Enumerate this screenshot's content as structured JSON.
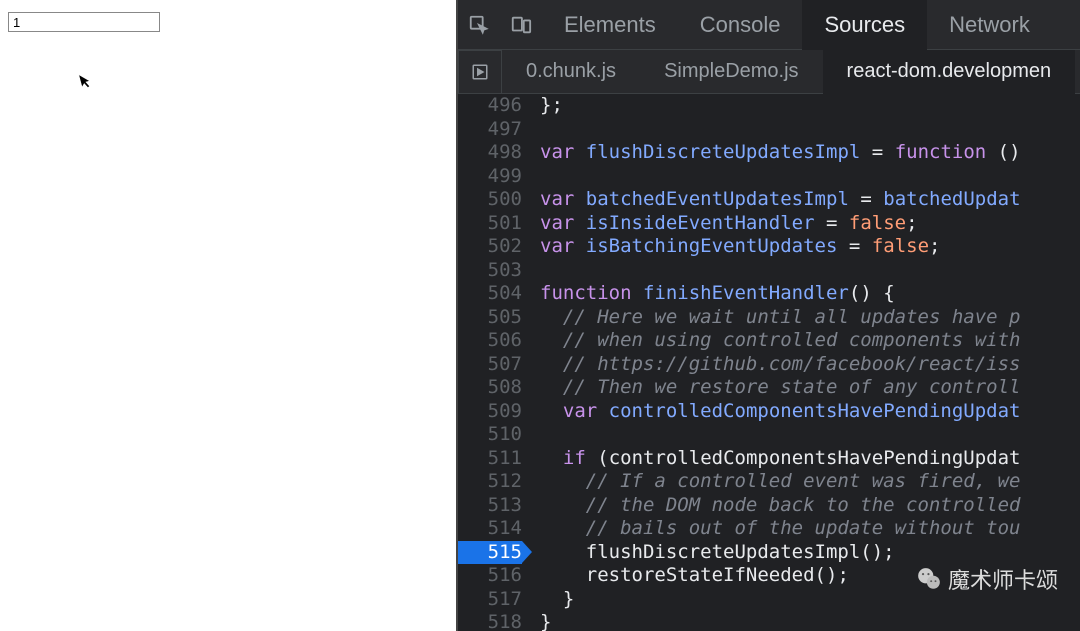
{
  "leftPane": {
    "inputValue": "1"
  },
  "devtools": {
    "mainTabs": [
      "Elements",
      "Console",
      "Sources",
      "Network"
    ],
    "activeMainTab": "Sources",
    "fileTabs": [
      "0.chunk.js",
      "SimpleDemo.js",
      "react-dom.developmen"
    ],
    "activeFileTab": "react-dom.developmen"
  },
  "code": {
    "startLine": 496,
    "highlightedLine": 515,
    "lines": [
      {
        "n": 496,
        "t": [
          {
            "c": "punct",
            "v": "};"
          }
        ]
      },
      {
        "n": 497,
        "t": []
      },
      {
        "n": 498,
        "t": [
          {
            "c": "kw",
            "v": "var"
          },
          {
            "c": "id",
            "v": " "
          },
          {
            "c": "fname",
            "v": "flushDiscreteUpdatesImpl"
          },
          {
            "c": "id",
            "v": " "
          },
          {
            "c": "punct",
            "v": "="
          },
          {
            "c": "id",
            "v": " "
          },
          {
            "c": "kw",
            "v": "function"
          },
          {
            "c": "id",
            "v": " "
          },
          {
            "c": "punct",
            "v": "()"
          }
        ]
      },
      {
        "n": 499,
        "t": []
      },
      {
        "n": 500,
        "t": [
          {
            "c": "kw",
            "v": "var"
          },
          {
            "c": "id",
            "v": " "
          },
          {
            "c": "fname",
            "v": "batchedEventUpdatesImpl"
          },
          {
            "c": "id",
            "v": " "
          },
          {
            "c": "punct",
            "v": "="
          },
          {
            "c": "id",
            "v": " "
          },
          {
            "c": "fname",
            "v": "batchedUpdat"
          }
        ]
      },
      {
        "n": 501,
        "t": [
          {
            "c": "kw",
            "v": "var"
          },
          {
            "c": "id",
            "v": " "
          },
          {
            "c": "fname",
            "v": "isInsideEventHandler"
          },
          {
            "c": "id",
            "v": " "
          },
          {
            "c": "punct",
            "v": "="
          },
          {
            "c": "id",
            "v": " "
          },
          {
            "c": "bool",
            "v": "false"
          },
          {
            "c": "punct",
            "v": ";"
          }
        ]
      },
      {
        "n": 502,
        "t": [
          {
            "c": "kw",
            "v": "var"
          },
          {
            "c": "id",
            "v": " "
          },
          {
            "c": "fname",
            "v": "isBatchingEventUpdates"
          },
          {
            "c": "id",
            "v": " "
          },
          {
            "c": "punct",
            "v": "="
          },
          {
            "c": "id",
            "v": " "
          },
          {
            "c": "bool",
            "v": "false"
          },
          {
            "c": "punct",
            "v": ";"
          }
        ]
      },
      {
        "n": 503,
        "t": []
      },
      {
        "n": 504,
        "t": [
          {
            "c": "kw",
            "v": "function"
          },
          {
            "c": "id",
            "v": " "
          },
          {
            "c": "fdec",
            "v": "finishEventHandler"
          },
          {
            "c": "punct",
            "v": "() {"
          }
        ]
      },
      {
        "n": 505,
        "t": [
          {
            "c": "id",
            "v": "  "
          },
          {
            "c": "comment",
            "v": "// Here we wait until all updates have p"
          }
        ]
      },
      {
        "n": 506,
        "t": [
          {
            "c": "id",
            "v": "  "
          },
          {
            "c": "comment",
            "v": "// when using controlled components with"
          }
        ]
      },
      {
        "n": 507,
        "t": [
          {
            "c": "id",
            "v": "  "
          },
          {
            "c": "comment",
            "v": "// https://github.com/facebook/react/iss"
          }
        ]
      },
      {
        "n": 508,
        "t": [
          {
            "c": "id",
            "v": "  "
          },
          {
            "c": "comment",
            "v": "// Then we restore state of any controll"
          }
        ]
      },
      {
        "n": 509,
        "t": [
          {
            "c": "id",
            "v": "  "
          },
          {
            "c": "kw",
            "v": "var"
          },
          {
            "c": "id",
            "v": " "
          },
          {
            "c": "fname",
            "v": "controlledComponentsHavePendingUpdat"
          }
        ]
      },
      {
        "n": 510,
        "t": []
      },
      {
        "n": 511,
        "t": [
          {
            "c": "id",
            "v": "  "
          },
          {
            "c": "kw",
            "v": "if"
          },
          {
            "c": "id",
            "v": " "
          },
          {
            "c": "punct",
            "v": "("
          },
          {
            "c": "id",
            "v": "controlledComponentsHavePendingUpdat"
          }
        ]
      },
      {
        "n": 512,
        "t": [
          {
            "c": "id",
            "v": "    "
          },
          {
            "c": "comment",
            "v": "// If a controlled event was fired, we"
          }
        ]
      },
      {
        "n": 513,
        "t": [
          {
            "c": "id",
            "v": "    "
          },
          {
            "c": "comment",
            "v": "// the DOM node back to the controlled"
          }
        ]
      },
      {
        "n": 514,
        "t": [
          {
            "c": "id",
            "v": "    "
          },
          {
            "c": "comment",
            "v": "// bails out of the update without tou"
          }
        ]
      },
      {
        "n": 515,
        "t": [
          {
            "c": "id",
            "v": "    flushDiscreteUpdatesImpl();"
          }
        ]
      },
      {
        "n": 516,
        "t": [
          {
            "c": "id",
            "v": "    restoreStateIfNeeded("
          },
          {
            "c": "punct",
            "v": ")"
          },
          {
            "c": "punct",
            "v": ";"
          }
        ]
      },
      {
        "n": 517,
        "t": [
          {
            "c": "id",
            "v": "  "
          },
          {
            "c": "punct",
            "v": "}"
          }
        ]
      },
      {
        "n": 518,
        "t": [
          {
            "c": "punct",
            "v": "}"
          }
        ]
      }
    ]
  },
  "watermark": {
    "text": "魔术师卡颂"
  }
}
